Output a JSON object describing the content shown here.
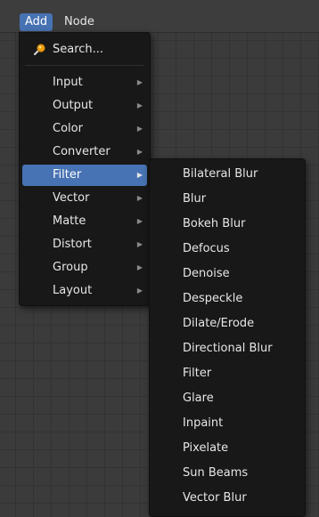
{
  "header": {
    "items": [
      {
        "label": "Add"
      },
      {
        "label": "Node"
      }
    ]
  },
  "add_menu": {
    "search_label": "Search...",
    "items": [
      {
        "label": "Input",
        "has_submenu": true
      },
      {
        "label": "Output",
        "has_submenu": true
      },
      {
        "label": "Color",
        "has_submenu": true
      },
      {
        "label": "Converter",
        "has_submenu": true
      },
      {
        "label": "Filter",
        "has_submenu": true,
        "highlighted": true
      },
      {
        "label": "Vector",
        "has_submenu": true
      },
      {
        "label": "Matte",
        "has_submenu": true
      },
      {
        "label": "Distort",
        "has_submenu": true
      },
      {
        "label": "Group",
        "has_submenu": true
      },
      {
        "label": "Layout",
        "has_submenu": true
      }
    ],
    "submenu_arrow": "▶"
  },
  "filter_submenu": {
    "items": [
      {
        "label": "Bilateral Blur"
      },
      {
        "label": "Blur"
      },
      {
        "label": "Bokeh Blur"
      },
      {
        "label": "Defocus"
      },
      {
        "label": "Denoise"
      },
      {
        "label": "Despeckle"
      },
      {
        "label": "Dilate/Erode"
      },
      {
        "label": "Directional Blur"
      },
      {
        "label": "Filter"
      },
      {
        "label": "Glare"
      },
      {
        "label": "Inpaint"
      },
      {
        "label": "Pixelate"
      },
      {
        "label": "Sun Beams"
      },
      {
        "label": "Vector Blur"
      }
    ]
  },
  "colors": {
    "accent": "#4772b3",
    "menu_bg": "#181818",
    "canvas_bg": "#3b3b3b"
  },
  "icons": {
    "search": "search-icon"
  }
}
